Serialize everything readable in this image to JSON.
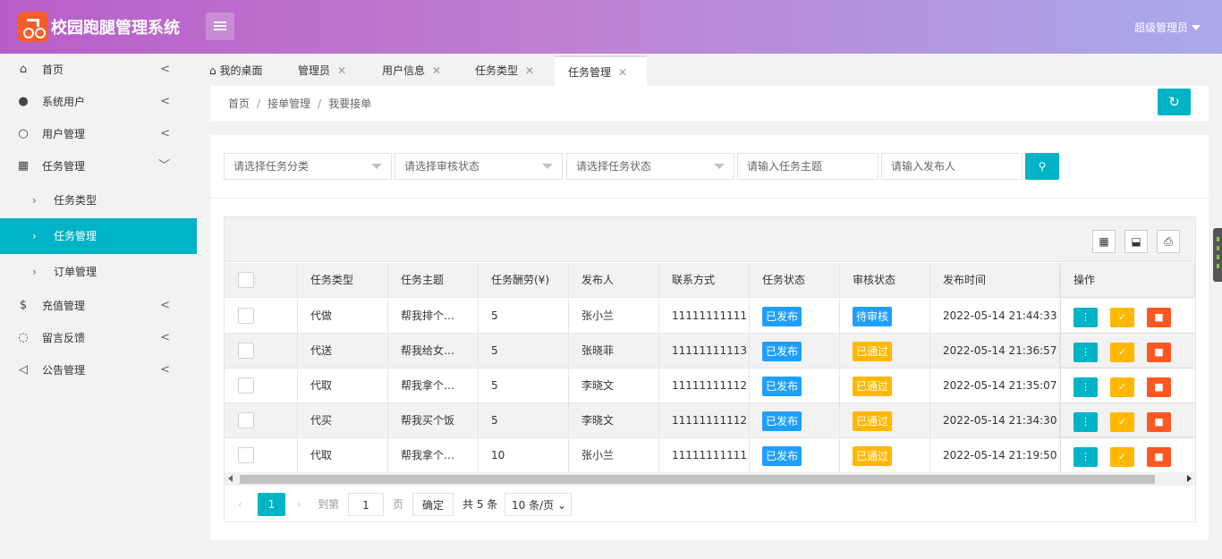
{
  "header": {
    "app_title": "校园跑腿管理系统",
    "user_label": "超级管理员"
  },
  "sidebar": {
    "items": [
      {
        "label": "首页",
        "icon": "home-icon"
      },
      {
        "label": "系统用户",
        "icon": "user-filled-icon"
      },
      {
        "label": "用户管理",
        "icon": "user-outline-icon"
      },
      {
        "label": "任务管理",
        "icon": "calendar-icon"
      },
      {
        "label": "充值管理",
        "icon": "dollar-icon"
      },
      {
        "label": "留言反馈",
        "icon": "chat-icon"
      },
      {
        "label": "公告管理",
        "icon": "speaker-icon"
      }
    ],
    "subitems": [
      {
        "label": "任务类型"
      },
      {
        "label": "任务管理"
      },
      {
        "label": "订单管理"
      }
    ],
    "active_color": "#00b3c7"
  },
  "tabs": [
    {
      "label": "我的桌面"
    },
    {
      "label": "管理员"
    },
    {
      "label": "用户信息"
    },
    {
      "label": "任务类型"
    },
    {
      "label": "任务管理"
    }
  ],
  "breadcrumb": [
    "首页",
    "接单管理",
    "我要接单"
  ],
  "filters": {
    "category_placeholder": "请选择任务分类",
    "review_placeholder": "请选择审核状态",
    "status_placeholder": "请选择任务状态",
    "subject_placeholder": "请输入任务主题",
    "publisher_placeholder": "请输入发布人"
  },
  "table": {
    "columns": [
      "任务类型",
      "任务主题",
      "任务酬劳(¥)",
      "发布人",
      "联系方式",
      "任务状态",
      "审核状态",
      "发布时间",
      "操作"
    ],
    "rows": [
      {
        "type": "代做",
        "subject": "帮我排个…",
        "reward": "5",
        "publisher": "张小兰",
        "contact": "11111111111",
        "status": "已发布",
        "review": "待审核",
        "time": "2022-05-14 21:44:33"
      },
      {
        "type": "代送",
        "subject": "帮我给女…",
        "reward": "5",
        "publisher": "张晓菲",
        "contact": "11111111113",
        "status": "已发布",
        "review": "已通过",
        "time": "2022-05-14 21:36:57"
      },
      {
        "type": "代取",
        "subject": "帮我拿个…",
        "reward": "5",
        "publisher": "李晓文",
        "contact": "11111111112",
        "status": "已发布",
        "review": "已通过",
        "time": "2022-05-14 21:35:07"
      },
      {
        "type": "代买",
        "subject": "帮我买个饭",
        "reward": "5",
        "publisher": "李晓文",
        "contact": "11111111112",
        "status": "已发布",
        "review": "已通过",
        "time": "2022-05-14 21:34:30"
      },
      {
        "type": "代取",
        "subject": "帮我拿个…",
        "reward": "10",
        "publisher": "张小兰",
        "contact": "11111111111",
        "status": "已发布",
        "review": "已通过",
        "time": "2022-05-14 21:19:50"
      }
    ]
  },
  "pagination": {
    "current_page": "1",
    "goto_label": "到第",
    "goto_value": "1",
    "page_label": "页",
    "confirm_label": "确定",
    "total_label": "共 5 条",
    "page_size_label": "10 条/页"
  },
  "colors": {
    "accent": "#00b3c7",
    "published": "#1e9fff",
    "pending": "#1e9fff",
    "approved": "#ffb800",
    "delete": "#ff5722"
  }
}
